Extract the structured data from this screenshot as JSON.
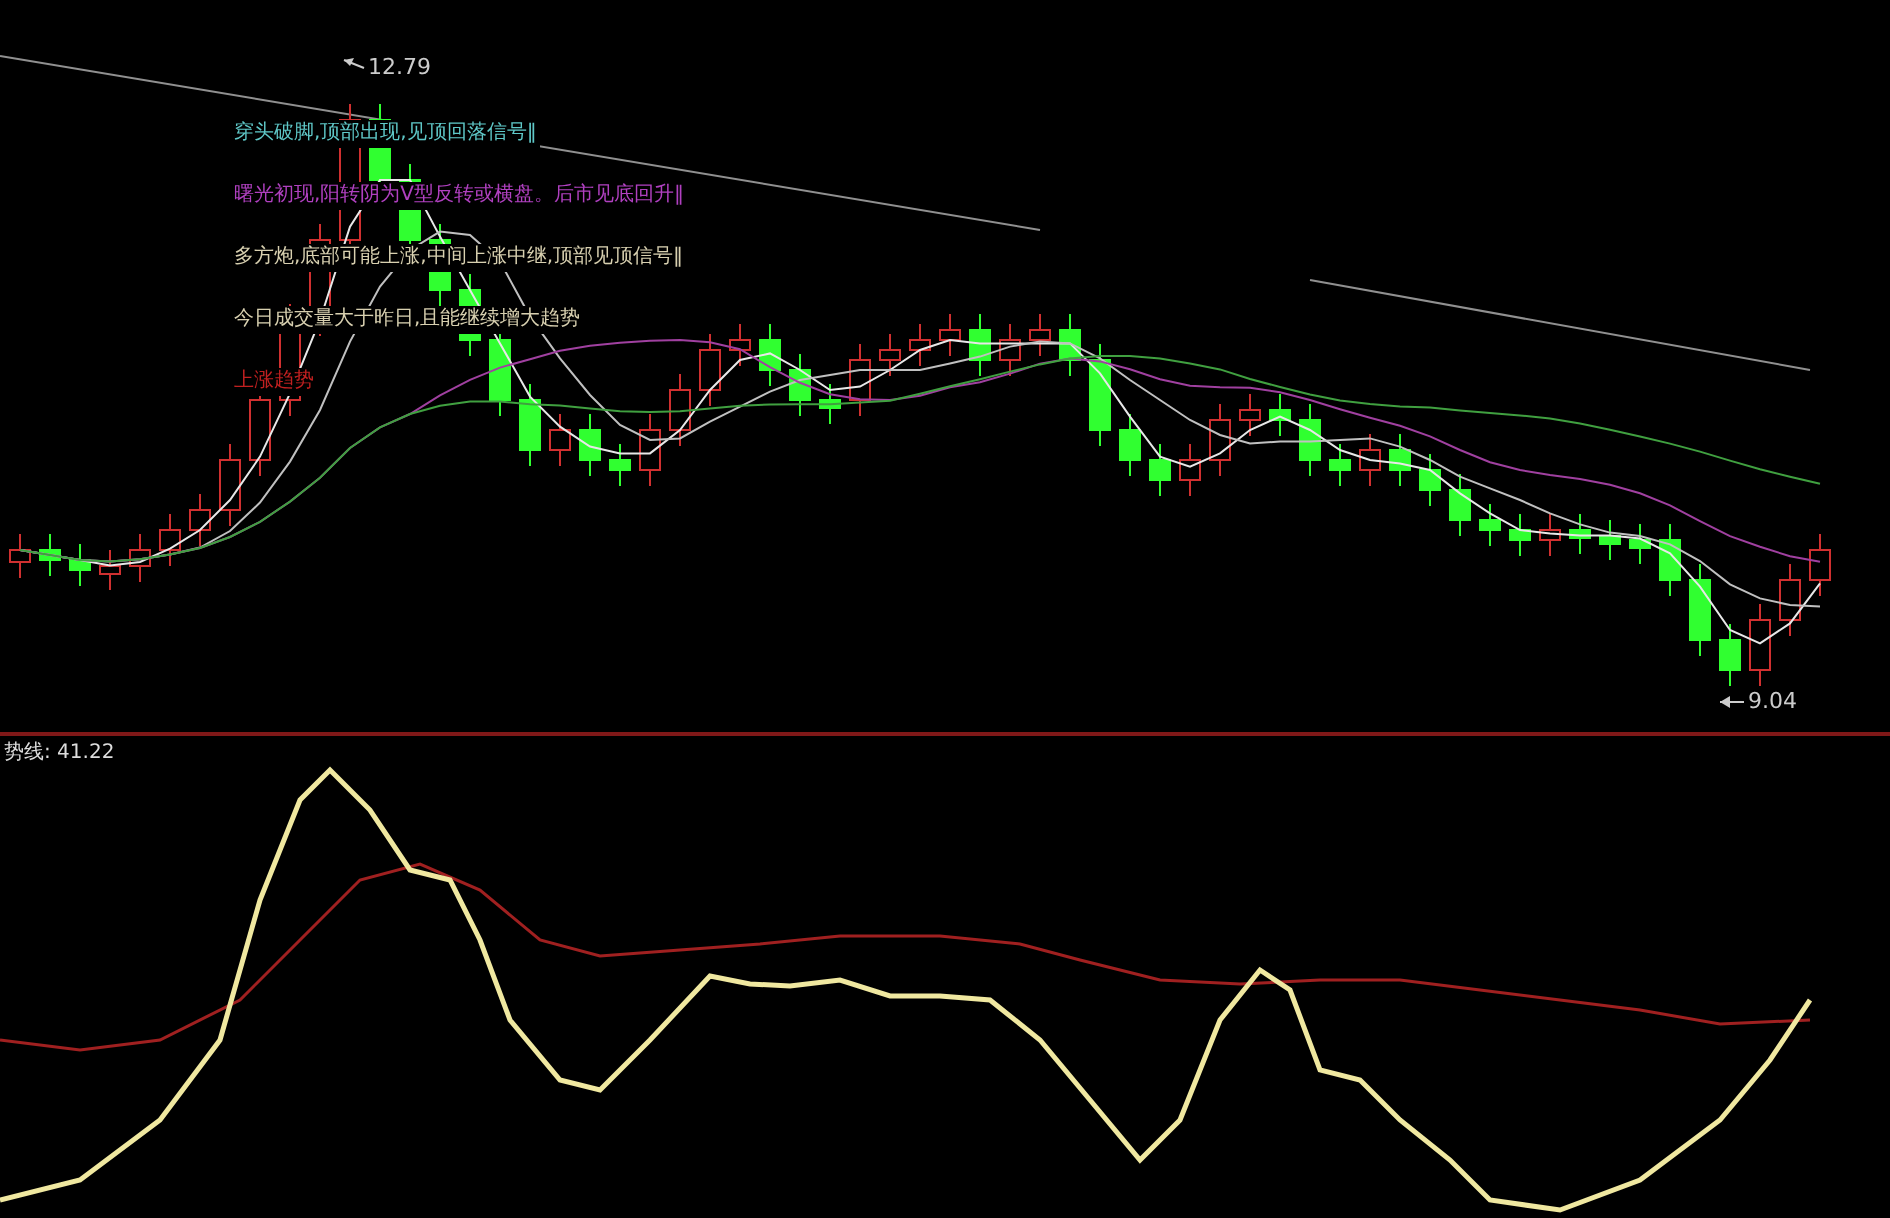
{
  "chart": {
    "high_label": "12.79",
    "low_label": "9.04",
    "signals": [
      {
        "text": "穿头破脚,顶部出现,见顶回落信号‖",
        "color": "#5fc8c8"
      },
      {
        "text": "曙光初现,阳转阴为V型反转或横盘。后市见底回升‖",
        "color": "#b040c0"
      },
      {
        "text": "多方炮,底部可能上涨,中间上涨中继,顶部见顶信号‖",
        "color": "#d8d0b0"
      },
      {
        "text": "今日成交量大于昨日,且能继续增大趋势",
        "color": "#d8d0b0"
      },
      {
        "text": "上涨趋势",
        "color": "#c02020"
      }
    ]
  },
  "indicator": {
    "label": "势线: 41.22"
  }
}
